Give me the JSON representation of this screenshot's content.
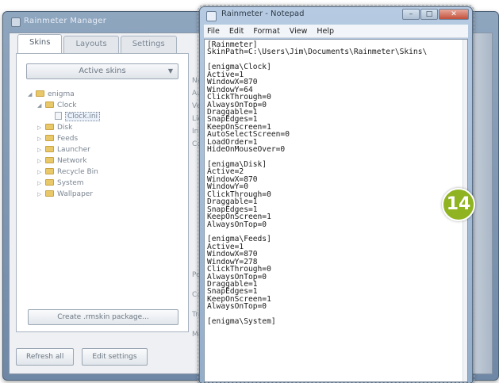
{
  "background_window": {
    "title": "Rainmeter Manager",
    "tabs": [
      {
        "label": "Skins",
        "active": true
      },
      {
        "label": "Layouts",
        "active": false
      },
      {
        "label": "Settings",
        "active": false
      }
    ],
    "active_skins_button": "Active skins",
    "tree": [
      {
        "label": "enigma",
        "type": "folder",
        "level": 0,
        "expander": "minus"
      },
      {
        "label": "Clock",
        "type": "folder",
        "level": 1,
        "expander": "minus"
      },
      {
        "label": "Clock.ini",
        "type": "file",
        "level": 2,
        "expander": "",
        "selected": true
      },
      {
        "label": "Disk",
        "type": "folder",
        "level": 1,
        "expander": "plus"
      },
      {
        "label": "Feeds",
        "type": "folder",
        "level": 1,
        "expander": "plus"
      },
      {
        "label": "Launcher",
        "type": "folder",
        "level": 1,
        "expander": "plus"
      },
      {
        "label": "Network",
        "type": "folder",
        "level": 1,
        "expander": "plus"
      },
      {
        "label": "Recycle Bin",
        "type": "folder",
        "level": 1,
        "expander": "plus"
      },
      {
        "label": "System",
        "type": "folder",
        "level": 1,
        "expander": "plus"
      },
      {
        "label": "Wallpaper",
        "type": "folder",
        "level": 1,
        "expander": "plus"
      }
    ],
    "create_package_button": "Create .rmskin package...",
    "right_labels": [
      "Na",
      "Au",
      "Ve",
      "Lic",
      "Inf",
      "Coo",
      "Pos",
      "Co",
      "Tra",
      "Ma"
    ],
    "bottom_buttons": [
      "Refresh all",
      "Edit settings"
    ]
  },
  "notepad": {
    "title": "Rainmeter - Notepad",
    "menu": [
      "File",
      "Edit",
      "Format",
      "View",
      "Help"
    ],
    "lines": [
      "[Rainmeter]",
      "SkinPath=C:\\Users\\Jim\\Documents\\Rainmeter\\Skins\\",
      "",
      "[enigma\\Clock]",
      "Active=1",
      "WindowX=870",
      "WindowY=64",
      "ClickThrough=0",
      "AlwaysOnTop=0",
      "Draggable=1",
      "SnapEdges=1",
      "KeepOnScreen=1",
      "AutoSelectScreen=0",
      "LoadOrder=1",
      "HideOnMouseOver=0",
      "",
      "[enigma\\Disk]",
      "Active=2",
      "WindowX=870",
      "WindowY=0",
      "ClickThrough=0",
      "Draggable=1",
      "SnapEdges=1",
      "KeepOnScreen=1",
      "AlwaysOnTop=0",
      "",
      "[enigma\\Feeds]",
      "Active=1",
      "WindowX=870",
      "WindowY=278",
      "ClickThrough=0",
      "AlwaysOnTop=0",
      "Draggable=1",
      "SnapEdges=1",
      "KeepOnScreen=1",
      "AlwaysOnTop=0",
      "",
      "[enigma\\System]"
    ]
  },
  "badge": {
    "number": "14",
    "color": "#8fb321"
  }
}
